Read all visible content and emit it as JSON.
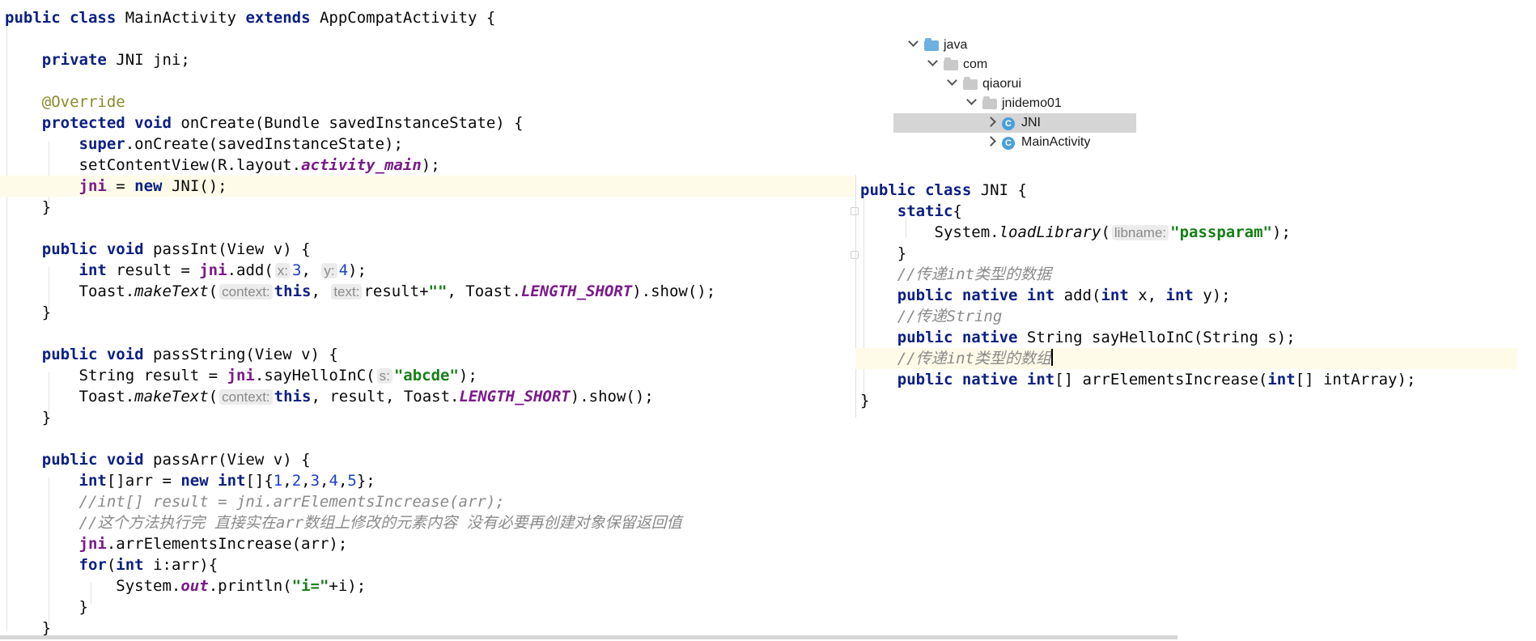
{
  "left_code": [
    [
      [
        "public class ",
        "kw"
      ],
      [
        "MainActivity ",
        ""
      ],
      [
        "extends ",
        "kw"
      ],
      [
        "AppCompatActivity {",
        ""
      ]
    ],
    [],
    [
      [
        "    ",
        ""
      ],
      [
        "private ",
        "kw"
      ],
      [
        "JNI ",
        ""
      ],
      [
        "jni",
        ""
      ],
      [
        ";",
        ""
      ]
    ],
    [],
    [
      [
        "    ",
        ""
      ],
      [
        "@Override",
        "ann"
      ]
    ],
    [
      [
        "    ",
        ""
      ],
      [
        "protected void ",
        "kw"
      ],
      [
        "onCreate(Bundle savedInstanceState) {",
        ""
      ]
    ],
    [
      [
        "        ",
        ""
      ],
      [
        "super",
        "kw"
      ],
      [
        ".onCreate(savedInstanceState);",
        ""
      ]
    ],
    [
      [
        "        ",
        ""
      ],
      [
        "setContentView(R.layout.",
        ""
      ],
      [
        "activity_main",
        "sfld"
      ],
      [
        ");",
        ""
      ]
    ],
    [
      [
        "        ",
        ""
      ],
      [
        "jni",
        "fld"
      ],
      [
        " = ",
        ""
      ],
      [
        "new ",
        "kw"
      ],
      [
        "JNI();",
        ""
      ]
    ],
    [
      [
        "    }",
        ""
      ]
    ],
    [],
    [
      [
        "    ",
        ""
      ],
      [
        "public void ",
        "kw"
      ],
      [
        "passInt(View v) {",
        ""
      ]
    ],
    [
      [
        "        ",
        ""
      ],
      [
        "int ",
        "kw"
      ],
      [
        "result = ",
        ""
      ],
      [
        "jni",
        "fld"
      ],
      [
        ".add(",
        ""
      ],
      [
        "x:",
        "hint"
      ],
      [
        "3",
        "num"
      ],
      [
        ", ",
        ""
      ],
      [
        "y:",
        "hint"
      ],
      [
        "4",
        "num"
      ],
      [
        ");",
        ""
      ]
    ],
    [
      [
        "        ",
        ""
      ],
      [
        "Toast.",
        ""
      ],
      [
        "makeText",
        "ital"
      ],
      [
        "(",
        ""
      ],
      [
        "context:",
        "hint"
      ],
      [
        "this",
        "kw"
      ],
      [
        ", ",
        ""
      ],
      [
        "text:",
        "hint"
      ],
      [
        "result+",
        ""
      ],
      [
        "\"\"",
        "str"
      ],
      [
        ", Toast.",
        ""
      ],
      [
        "LENGTH_SHORT",
        "sfld"
      ],
      [
        ").show();",
        ""
      ]
    ],
    [
      [
        "    }",
        ""
      ]
    ],
    [],
    [
      [
        "    ",
        ""
      ],
      [
        "public void ",
        "kw"
      ],
      [
        "passString(View v) {",
        ""
      ]
    ],
    [
      [
        "        ",
        ""
      ],
      [
        "String result = ",
        ""
      ],
      [
        "jni",
        "fld"
      ],
      [
        ".sayHelloInC(",
        ""
      ],
      [
        "s:",
        "hint"
      ],
      [
        "\"abcde\"",
        "str"
      ],
      [
        ");",
        ""
      ]
    ],
    [
      [
        "        ",
        ""
      ],
      [
        "Toast.",
        ""
      ],
      [
        "makeText",
        "ital"
      ],
      [
        "(",
        ""
      ],
      [
        "context:",
        "hint"
      ],
      [
        "this",
        "kw"
      ],
      [
        ", result, Toast.",
        ""
      ],
      [
        "LENGTH_SHORT",
        "sfld"
      ],
      [
        ").show();",
        ""
      ]
    ],
    [
      [
        "    }",
        ""
      ]
    ],
    [],
    [
      [
        "    ",
        ""
      ],
      [
        "public void ",
        "kw"
      ],
      [
        "passArr(View v) {",
        ""
      ]
    ],
    [
      [
        "        ",
        ""
      ],
      [
        "int",
        "kw"
      ],
      [
        "[]arr = ",
        ""
      ],
      [
        "new ",
        "kw"
      ],
      [
        "int",
        "kw"
      ],
      [
        "[]{",
        ""
      ],
      [
        "1",
        "num"
      ],
      [
        ",",
        ""
      ],
      [
        "2",
        "num"
      ],
      [
        ",",
        ""
      ],
      [
        "3",
        "num"
      ],
      [
        ",",
        ""
      ],
      [
        "4",
        "num"
      ],
      [
        ",",
        ""
      ],
      [
        "5",
        "num"
      ],
      [
        "};",
        ""
      ]
    ],
    [
      [
        "        ",
        ""
      ],
      [
        "//int[] result = jni.arrElementsIncrease(arr);",
        "cmt"
      ]
    ],
    [
      [
        "        ",
        ""
      ],
      [
        "//这个方法执行完 直接实在arr数组上修改的元素内容 没有必要再创建对象保留返回值",
        "cmt"
      ]
    ],
    [
      [
        "        ",
        ""
      ],
      [
        "jni",
        "fld"
      ],
      [
        ".arrElementsIncrease(arr);",
        ""
      ]
    ],
    [
      [
        "        ",
        ""
      ],
      [
        "for",
        "kw"
      ],
      [
        "(",
        ""
      ],
      [
        "int ",
        "kw"
      ],
      [
        "i:arr){",
        ""
      ]
    ],
    [
      [
        "            ",
        ""
      ],
      [
        "System.",
        ""
      ],
      [
        "out",
        "sfld"
      ],
      [
        ".println(",
        ""
      ],
      [
        "\"i=\"",
        "str"
      ],
      [
        "+i);",
        ""
      ]
    ],
    [
      [
        "        }",
        ""
      ]
    ],
    [
      [
        "    }",
        ""
      ]
    ]
  ],
  "right_code": [
    [
      [
        "public class ",
        "kw"
      ],
      [
        "JNI {",
        ""
      ]
    ],
    [
      [
        "    ",
        ""
      ],
      [
        "static",
        "kw"
      ],
      [
        "{",
        ""
      ]
    ],
    [
      [
        "        ",
        ""
      ],
      [
        "System.",
        ""
      ],
      [
        "loadLibrary",
        "ital"
      ],
      [
        "(",
        ""
      ],
      [
        "libname:",
        "hint"
      ],
      [
        "\"passparam\"",
        "str"
      ],
      [
        ");",
        ""
      ]
    ],
    [
      [
        "    }",
        ""
      ]
    ],
    [
      [
        "    ",
        ""
      ],
      [
        "//传递int类型的数据",
        "cmt"
      ]
    ],
    [
      [
        "    ",
        ""
      ],
      [
        "public native int ",
        "kw"
      ],
      [
        "add(",
        ""
      ],
      [
        "int ",
        "kw"
      ],
      [
        "x, ",
        ""
      ],
      [
        "int ",
        "kw"
      ],
      [
        "y);",
        ""
      ]
    ],
    [
      [
        "    ",
        ""
      ],
      [
        "//传递String",
        "cmt"
      ]
    ],
    [
      [
        "    ",
        ""
      ],
      [
        "public native ",
        "kw"
      ],
      [
        "String sayHelloInC(String s);",
        ""
      ]
    ],
    [
      [
        "    ",
        ""
      ],
      [
        "//传递int类型的数组",
        "cmt"
      ]
    ],
    [
      [
        "    ",
        ""
      ],
      [
        "public native int",
        "kw"
      ],
      [
        "[] arrElementsIncrease(",
        ""
      ],
      [
        "int",
        "kw"
      ],
      [
        "[] intArray);",
        ""
      ]
    ],
    [
      [
        "}",
        ""
      ]
    ]
  ],
  "tree": [
    {
      "label": "java",
      "icon": "folder-java",
      "expanded": true
    },
    {
      "label": "com",
      "icon": "folder-pkg",
      "expanded": true
    },
    {
      "label": "qiaorui",
      "icon": "folder-pkg",
      "expanded": true
    },
    {
      "label": "jnidemo01",
      "icon": "folder-pkg",
      "expanded": true
    },
    {
      "label": "JNI",
      "icon": "class",
      "expanded": false,
      "selected": true
    },
    {
      "label": "MainActivity",
      "icon": "class",
      "expanded": false
    }
  ],
  "class_icon_glyph": "C",
  "colors": {
    "keyword": "#0b1f84",
    "field": "#7a1a8a",
    "string": "#167f16",
    "number": "#1940c8",
    "comment": "#8a8a8a",
    "annotation": "#8a8a2b",
    "line_highlight": "#fefbe9"
  }
}
